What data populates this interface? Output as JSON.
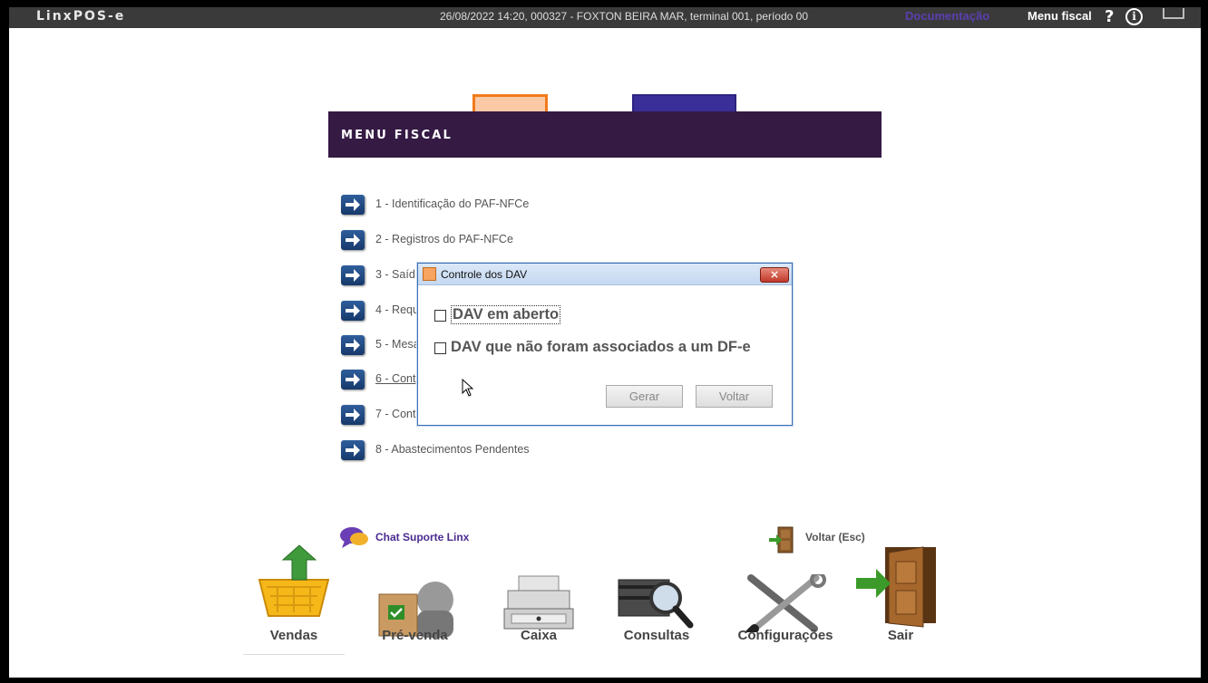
{
  "topbar": {
    "logo": "LinxPOS-e",
    "session": "26/08/2022 14:20, 000327 - FOXTON BEIRA MAR, terminal 001, período 00",
    "doc_link": "Documentação",
    "menu_fiscal_link": "Menu fiscal",
    "help": "?",
    "info": "i"
  },
  "menu": {
    "title": "MENU FISCAL",
    "items": [
      {
        "label": "1 - Identificação do PAF-NFCe"
      },
      {
        "label": "2 - Registros do PAF-NFCe"
      },
      {
        "label": "3 - Saíd"
      },
      {
        "label": "4 - Requ"
      },
      {
        "label": "5 - Mesa"
      },
      {
        "label": "6 - Cont"
      },
      {
        "label": "7 - Cont"
      },
      {
        "label": "8 - Abastecimentos Pendentes"
      }
    ]
  },
  "dialog": {
    "title": "Controle dos DAV",
    "close": "×",
    "options": [
      {
        "label": "DAV em aberto",
        "checked": false
      },
      {
        "label": "DAV que não foram associados a um DF-e",
        "checked": false
      }
    ],
    "gerar_label": "Gerar",
    "voltar_label": "Voltar"
  },
  "footer": {
    "chat_label": "Chat Suporte Linx",
    "voltar_esc": "Voltar (Esc)",
    "dock": [
      {
        "label": "Vendas",
        "icon": "basket-icon"
      },
      {
        "label": "Pré-venda",
        "icon": "pre-sale-icon"
      },
      {
        "label": "Caixa",
        "icon": "cash-register-icon"
      },
      {
        "label": "Consultas",
        "icon": "magnifier-icon"
      },
      {
        "label": "Configurações",
        "icon": "tools-icon"
      },
      {
        "label": "Sair",
        "icon": "exit-door-icon"
      }
    ]
  },
  "colors": {
    "header_purple": "#351a44",
    "link_purple": "#5b3fb0",
    "topbar": "#3a3a3a"
  }
}
